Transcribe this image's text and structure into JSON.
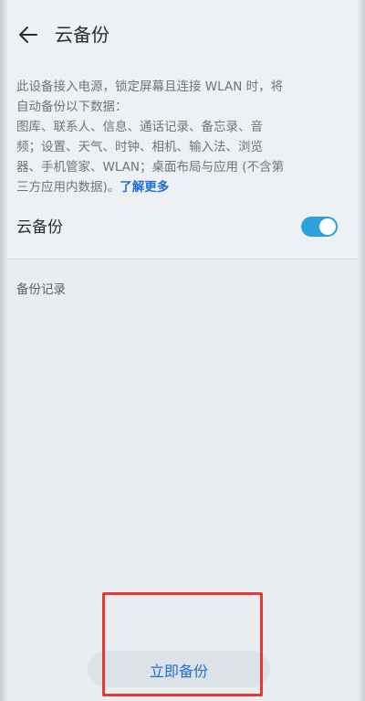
{
  "header": {
    "title": "云备份",
    "back_icon": "arrow-left-icon"
  },
  "description": {
    "lines": [
      "此设备接入电源，锁定屏幕且连接 WLAN 时，将",
      "自动备份以下数据：",
      "图库、联系人、信息、通话记录、备忘录、音",
      "频；设置、天气、时钟、相机、输入法、浏览",
      "器、手机管家、WLAN；桌面布局与应用 (不含第"
    ],
    "last_line": "三方应用内数据)。",
    "learn_more": "了解更多"
  },
  "cloud_backup": {
    "label": "云备份",
    "enabled": true
  },
  "records": {
    "label": "备份记录"
  },
  "backup_now": {
    "label": "立即备份"
  },
  "colors": {
    "accent": "#1f6fd6",
    "switch_on": "#2aa3dc",
    "highlight": "#e53935"
  }
}
